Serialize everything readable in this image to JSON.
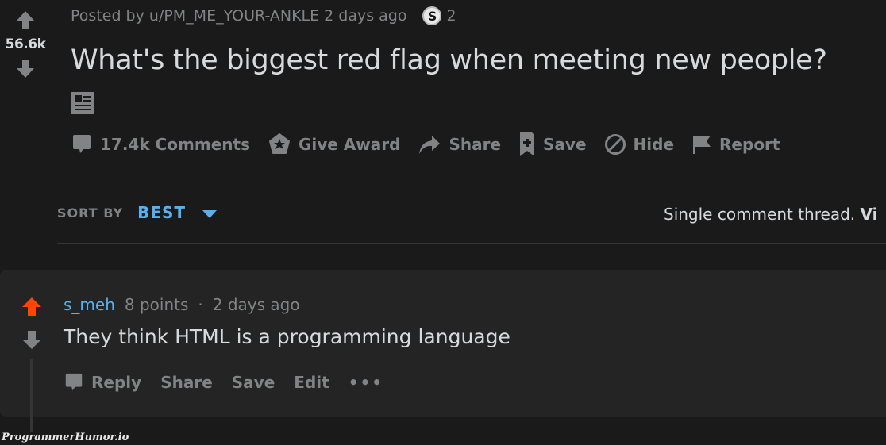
{
  "post": {
    "vote_count": "56.6k",
    "meta": {
      "posted_by": "Posted by u/PM_ME_YOUR-ANKLE",
      "time": "2 days ago",
      "award_badge_letter": "S",
      "award_count": "2"
    },
    "title": "What's the biggest red flag when meeting new people?",
    "post_type_icon": "text-post-icon",
    "actions": [
      {
        "icon": "comment-icon",
        "label": "17.4k Comments"
      },
      {
        "icon": "award-icon",
        "label": "Give Award"
      },
      {
        "icon": "share-icon",
        "label": "Share"
      },
      {
        "icon": "bookmark-icon",
        "label": "Save"
      },
      {
        "icon": "hide-icon",
        "label": "Hide"
      },
      {
        "icon": "flag-icon",
        "label": "Report"
      }
    ]
  },
  "sort": {
    "label": "SORT BY",
    "value": "BEST"
  },
  "thread_notice": {
    "text": "Single comment thread. ",
    "link": "Vi"
  },
  "comment": {
    "author": "s_meh",
    "points": "8 points",
    "separator": "·",
    "time": "2 days ago",
    "body": "They think HTML is a programming language",
    "upvoted": true,
    "actions": [
      {
        "icon": "comment-icon",
        "label": "Reply"
      },
      {
        "icon": "",
        "label": "Share"
      },
      {
        "icon": "",
        "label": "Save"
      },
      {
        "icon": "",
        "label": "Edit"
      },
      {
        "icon": "more-icon",
        "label": "•••"
      }
    ]
  },
  "colors": {
    "background": "#1a1a1b",
    "comment_background": "#242424",
    "muted_text": "#818384",
    "primary_text": "#d7dadc",
    "accent_blue": "#58b0ee",
    "upvote_orange": "#ff4500"
  },
  "watermark": "ProgrammerHumor.io"
}
